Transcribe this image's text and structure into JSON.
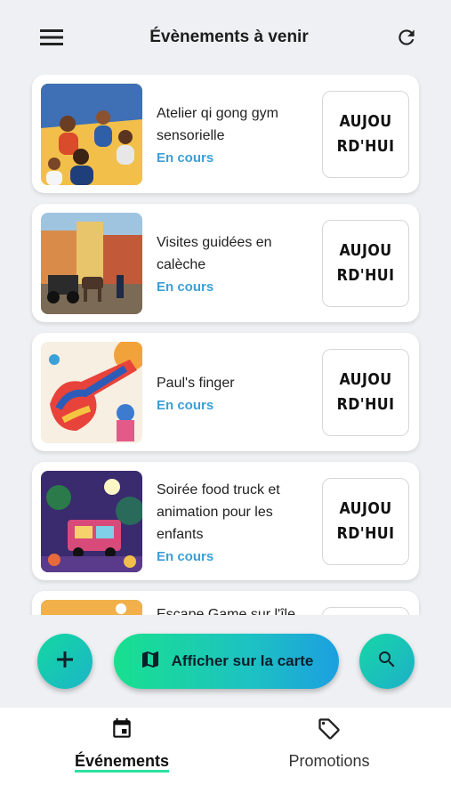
{
  "header": {
    "title": "Évènements à venir",
    "menu_icon": "hamburger-menu-icon",
    "refresh_icon": "refresh-icon"
  },
  "events": [
    {
      "title": "Atelier qi gong gym sensorielle",
      "status": "En cours",
      "date_label": "AUJOURD'HUI",
      "image": "group-meditation-illustration"
    },
    {
      "title": "Visites guidées en calèche",
      "status": "En cours",
      "date_label": "AUJOURD'HUI",
      "image": "horse-carriage-street-illustration"
    },
    {
      "title": "Paul's finger",
      "status": "En cours",
      "date_label": "AUJOURD'HUI",
      "image": "colorful-thumb-illustration"
    },
    {
      "title": "Soirée food truck et animation pour les enfants",
      "status": "En cours",
      "date_label": "AUJOURD'HUI",
      "image": "food-truck-night-illustration"
    },
    {
      "title": "Escape Game sur l'île",
      "status": "",
      "date_label": "",
      "image": "island-sky-illustration"
    }
  ],
  "actions": {
    "add_icon": "plus-icon",
    "map_label": "Afficher sur la carte",
    "map_icon": "map-icon",
    "search_icon": "search-icon"
  },
  "nav": {
    "events_label": "Événements",
    "promotions_label": "Promotions"
  },
  "colors": {
    "accent": "#3aa0d8",
    "gradient_start": "#18e08e",
    "gradient_end": "#1c9fe0"
  }
}
